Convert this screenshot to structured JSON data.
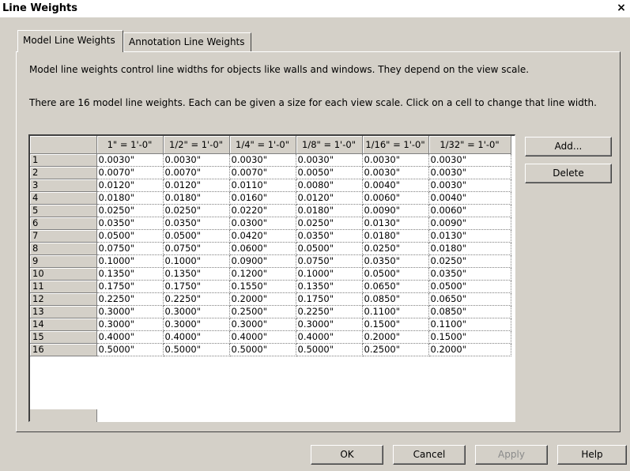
{
  "window": {
    "title": "Line Weights",
    "close_label": "×"
  },
  "tabs": [
    {
      "label": "Model Line Weights",
      "active": true
    },
    {
      "label": "Annotation Line Weights",
      "active": false
    }
  ],
  "description": {
    "line1": "Model line weights control line widths for objects like walls and windows. They depend on the view scale.",
    "line2": "There are 16 model line weights. Each can be given a size for each view scale. Click on a cell to change that line width."
  },
  "grid": {
    "columns": [
      "1\" = 1'-0\"",
      "1/2\" = 1'-0\"",
      "1/4\" = 1'-0\"",
      "1/8\" = 1'-0\"",
      "1/16\" = 1'-0\"",
      "1/32\" = 1'-0\""
    ],
    "rows": [
      {
        "label": "1",
        "values": [
          "0.0030\"",
          "0.0030\"",
          "0.0030\"",
          "0.0030\"",
          "0.0030\"",
          "0.0030\""
        ]
      },
      {
        "label": "2",
        "values": [
          "0.0070\"",
          "0.0070\"",
          "0.0070\"",
          "0.0050\"",
          "0.0030\"",
          "0.0030\""
        ]
      },
      {
        "label": "3",
        "values": [
          "0.0120\"",
          "0.0120\"",
          "0.0110\"",
          "0.0080\"",
          "0.0040\"",
          "0.0030\""
        ]
      },
      {
        "label": "4",
        "values": [
          "0.0180\"",
          "0.0180\"",
          "0.0160\"",
          "0.0120\"",
          "0.0060\"",
          "0.0040\""
        ]
      },
      {
        "label": "5",
        "values": [
          "0.0250\"",
          "0.0250\"",
          "0.0220\"",
          "0.0180\"",
          "0.0090\"",
          "0.0060\""
        ]
      },
      {
        "label": "6",
        "values": [
          "0.0350\"",
          "0.0350\"",
          "0.0300\"",
          "0.0250\"",
          "0.0130\"",
          "0.0090\""
        ]
      },
      {
        "label": "7",
        "values": [
          "0.0500\"",
          "0.0500\"",
          "0.0420\"",
          "0.0350\"",
          "0.0180\"",
          "0.0130\""
        ]
      },
      {
        "label": "8",
        "values": [
          "0.0750\"",
          "0.0750\"",
          "0.0600\"",
          "0.0500\"",
          "0.0250\"",
          "0.0180\""
        ]
      },
      {
        "label": "9",
        "values": [
          "0.1000\"",
          "0.1000\"",
          "0.0900\"",
          "0.0750\"",
          "0.0350\"",
          "0.0250\""
        ]
      },
      {
        "label": "10",
        "values": [
          "0.1350\"",
          "0.1350\"",
          "0.1200\"",
          "0.1000\"",
          "0.0500\"",
          "0.0350\""
        ]
      },
      {
        "label": "11",
        "values": [
          "0.1750\"",
          "0.1750\"",
          "0.1550\"",
          "0.1350\"",
          "0.0650\"",
          "0.0500\""
        ]
      },
      {
        "label": "12",
        "values": [
          "0.2250\"",
          "0.2250\"",
          "0.2000\"",
          "0.1750\"",
          "0.0850\"",
          "0.0650\""
        ]
      },
      {
        "label": "13",
        "values": [
          "0.3000\"",
          "0.3000\"",
          "0.2500\"",
          "0.2250\"",
          "0.1100\"",
          "0.0850\""
        ]
      },
      {
        "label": "14",
        "values": [
          "0.3000\"",
          "0.3000\"",
          "0.3000\"",
          "0.3000\"",
          "0.1500\"",
          "0.1100\""
        ]
      },
      {
        "label": "15",
        "values": [
          "0.4000\"",
          "0.4000\"",
          "0.4000\"",
          "0.4000\"",
          "0.2000\"",
          "0.1500\""
        ]
      },
      {
        "label": "16",
        "values": [
          "0.5000\"",
          "0.5000\"",
          "0.5000\"",
          "0.5000\"",
          "0.2500\"",
          "0.2000\""
        ]
      }
    ]
  },
  "side_buttons": {
    "add": "Add...",
    "delete": "Delete"
  },
  "footer": {
    "ok": "OK",
    "cancel": "Cancel",
    "apply": "Apply",
    "help": "Help",
    "apply_disabled": true
  }
}
